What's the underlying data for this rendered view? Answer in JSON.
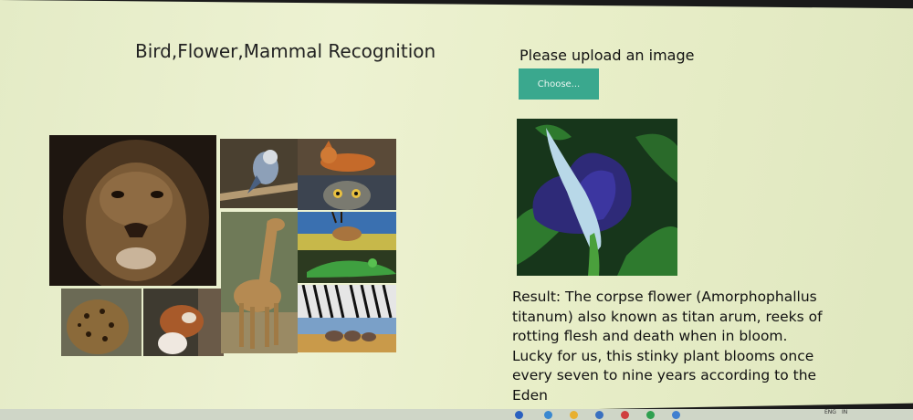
{
  "app": {
    "title": "Bird,Flower,Mammal Recognition"
  },
  "upload": {
    "label": "Please upload an image",
    "button_label": "Choose..."
  },
  "result": {
    "text": "Result: The corpse flower (Amorphophallus titanum) also known as titan arum, reeks of rotting flesh and death when in bloom. Lucky for us, this stinky plant blooms once every seven to nine years according to the Eden"
  },
  "collage_tiles": [
    {
      "name": "lion-photo"
    },
    {
      "name": "bird-photo"
    },
    {
      "name": "fox-photo"
    },
    {
      "name": "owl-photo"
    },
    {
      "name": "giraffe-photo"
    },
    {
      "name": "antelope-photo"
    },
    {
      "name": "lizard-photo"
    },
    {
      "name": "zebra-photo"
    },
    {
      "name": "elephants-photo"
    },
    {
      "name": "leopard-photo"
    },
    {
      "name": "red-panda-photo"
    }
  ],
  "taskbar": {
    "tray_lang": "ENG",
    "tray_region": "IN"
  },
  "colors": {
    "accent_button": "#3aa88e",
    "page_background": "#e9efcb"
  }
}
